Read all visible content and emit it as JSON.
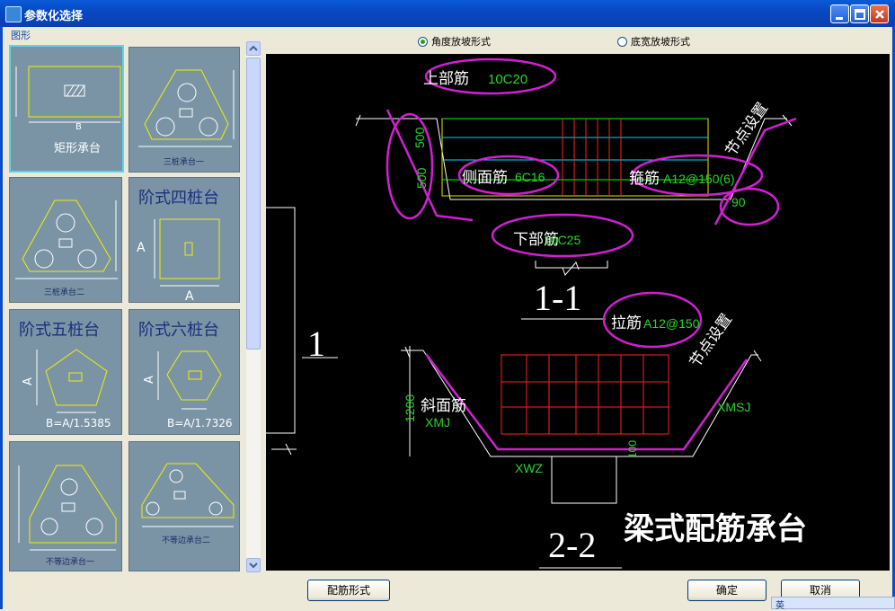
{
  "window": {
    "title": "参数化选择"
  },
  "left": {
    "group_label": "图形",
    "thumbnails": [
      {
        "label": "矩形承台",
        "dim": "B"
      },
      {
        "label": "三桩承台一"
      },
      {
        "label": "三桩承台二"
      },
      {
        "label": "阶式四桩台",
        "dim_a": "A",
        "dim_b": "A"
      },
      {
        "label": "阶式五桩台",
        "dim_a": "A",
        "formula": "B=A/1.5385"
      },
      {
        "label": "阶式六桩台",
        "dim_a": "A",
        "formula": "B=A/1.7326"
      },
      {
        "label": "不等边承台一"
      },
      {
        "label": "不等边承台二"
      }
    ]
  },
  "options": {
    "angle_label": "角度放坡形式",
    "width_label": "底宽放坡形式",
    "selected": "angle"
  },
  "drawing": {
    "top_rebar_name": "上部筋",
    "top_rebar_val": "10C20",
    "side_rebar_name": "侧面筋",
    "side_rebar_val": "6C16",
    "stirrup_name": "箍筋",
    "stirrup_val": "A12@150(6)",
    "bottom_rebar_name": "下部筋",
    "bottom_rebar_val": "10C25",
    "dim_500a": "500",
    "dim_500b": "500",
    "dim_90": "90",
    "node_set": "节点设置",
    "section_11": "1-1",
    "tie_name": "拉筋",
    "tie_val": "A12@150",
    "section_1": "1",
    "dim_1200": "1200",
    "slope_name": "斜面筋",
    "xmj": "XMJ",
    "xmsj": "XMSJ",
    "xwz": "XWZ",
    "dim_100": "100",
    "section_22": "2-2",
    "caption": "梁式配筋承台"
  },
  "buttons": {
    "rebar_form": "配筋形式",
    "ok": "确定",
    "cancel": "取消"
  },
  "tray": {
    "text": "英"
  }
}
